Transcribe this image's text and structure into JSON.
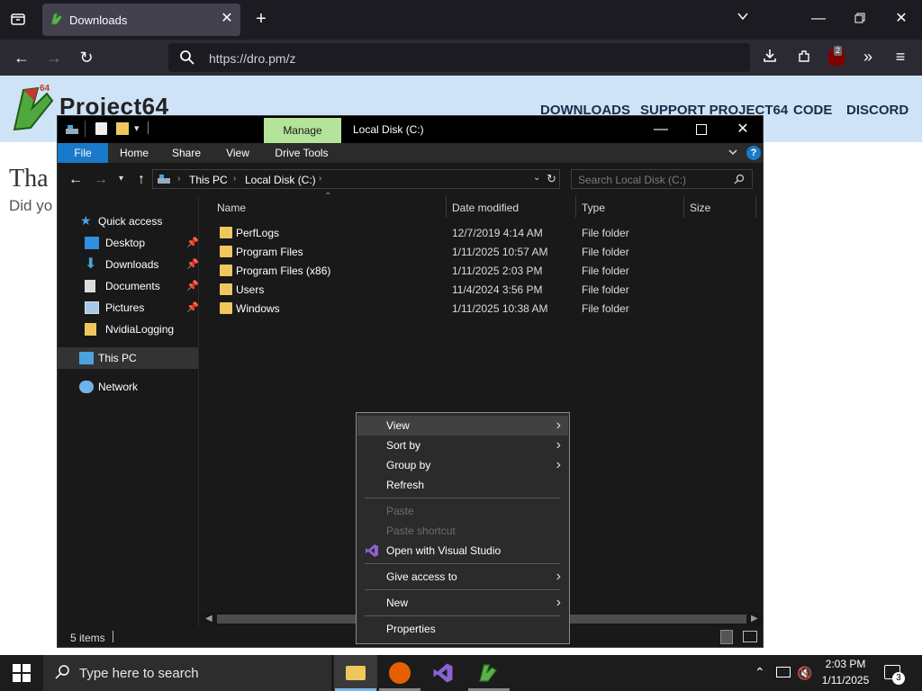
{
  "browser": {
    "tab_title": "Downloads",
    "url": "https://dro.pm/z",
    "addon_badge": "2"
  },
  "site": {
    "logo_text": "Project64",
    "logo_badge": "64",
    "nav": [
      "DOWNLOADS",
      "SUPPORT PROJECT64",
      "CODE",
      "DISCORD"
    ],
    "heading_partial": "Tha",
    "subtext_partial": "Did yo"
  },
  "explorer": {
    "title": "Local Disk (C:)",
    "manage_tab": "Manage",
    "ribbon_tabs": [
      "File",
      "Home",
      "Share",
      "View",
      "Drive Tools"
    ],
    "breadcrumb": [
      "This PC",
      "Local Disk (C:)"
    ],
    "search_placeholder": "Search Local Disk (C:)",
    "columns": {
      "name": "Name",
      "date": "Date modified",
      "type": "Type",
      "size": "Size"
    },
    "nav": {
      "quick_access": "Quick access",
      "desktop": "Desktop",
      "downloads": "Downloads",
      "documents": "Documents",
      "pictures": "Pictures",
      "nvidia": "NvidiaLogging",
      "this_pc": "This PC",
      "network": "Network"
    },
    "files": [
      {
        "name": "PerfLogs",
        "date": "12/7/2019 4:14 AM",
        "type": "File folder"
      },
      {
        "name": "Program Files",
        "date": "1/11/2025 10:57 AM",
        "type": "File folder"
      },
      {
        "name": "Program Files (x86)",
        "date": "1/11/2025 2:03 PM",
        "type": "File folder"
      },
      {
        "name": "Users",
        "date": "11/4/2024 3:56 PM",
        "type": "File folder"
      },
      {
        "name": "Windows",
        "date": "1/11/2025 10:38 AM",
        "type": "File folder"
      }
    ],
    "status": "5 items"
  },
  "context_menu": {
    "view": "View",
    "sort_by": "Sort by",
    "group_by": "Group by",
    "refresh": "Refresh",
    "paste": "Paste",
    "paste_shortcut": "Paste shortcut",
    "open_vs": "Open with Visual Studio",
    "give_access": "Give access to",
    "new": "New",
    "properties": "Properties"
  },
  "taskbar": {
    "search_placeholder": "Type here to search",
    "time": "2:03 PM",
    "date": "1/11/2025",
    "notifications": "3"
  },
  "colors": {
    "manage_tab": "#b4e39a",
    "file_tab": "#1979ca",
    "folder": "#f0c75e",
    "explorer_bg": "#191919"
  }
}
